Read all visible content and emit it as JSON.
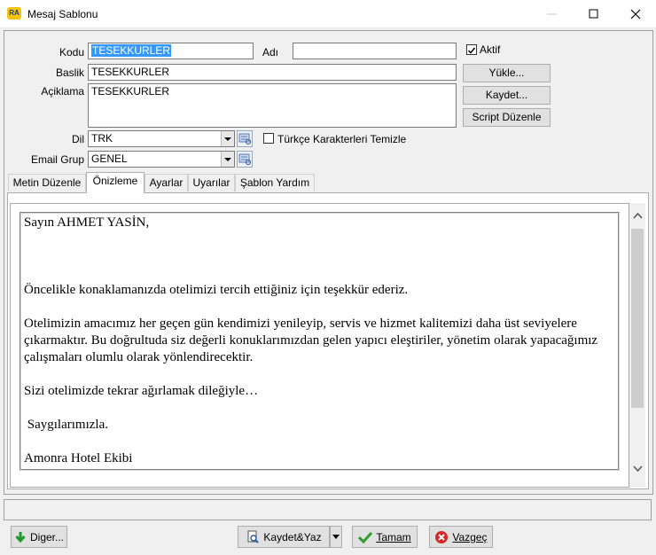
{
  "window": {
    "app_icon_text": "RA",
    "title": "Mesaj Sablonu"
  },
  "form": {
    "kodu_label": "Kodu",
    "kodu_value": "TESEKKURLER",
    "adi_label": "Adı",
    "adi_value": "",
    "aktif_label": "Aktif",
    "aktif_checked": true,
    "baslik_label": "Baslik",
    "baslik_value": "TESEKKURLER",
    "aciklama_label": "Açiklama",
    "aciklama_value": "TESEKKURLER",
    "dil_label": "Dil",
    "dil_value": "TRK",
    "turkce_label": "Türkçe Karakterleri Temizle",
    "turkce_checked": false,
    "email_grup_label": "Email Grup",
    "email_grup_value": "GENEL"
  },
  "side_buttons": {
    "yukle": "Yükle...",
    "kaydet": "Kaydet...",
    "script": "Script Düzenle"
  },
  "tabs": [
    {
      "label": "Metin Düzenle",
      "active": false
    },
    {
      "label": "Önizleme",
      "active": true
    },
    {
      "label": "Ayarlar",
      "active": false
    },
    {
      "label": "Uyarılar",
      "active": false
    },
    {
      "label": "Şablon Yardım",
      "active": false
    }
  ],
  "preview": {
    "lines": [
      "Sayın AHMET YASİN,",
      "",
      "",
      "",
      "Öncelikle konaklamanızda otelimizi tercih ettiğiniz için teşekkür ederiz.",
      "",
      "Otelimizin amacımız her geçen gün kendimizi yenileyip, servis ve hizmet kalitemizi daha üst seviyelere",
      "çıkarmaktır. Bu doğrultuda siz değerli konuklarımızdan gelen yapıcı eleştiriler, yönetim olarak yapacağımız",
      "çalışmaları olumlu olarak yönlendirecektir.",
      "",
      "Sizi otelimizde tekrar ağırlamak dileğiyle…",
      "",
      " Saygılarımızla.",
      "",
      "Amonra Hotel Ekibi"
    ]
  },
  "bottom_buttons": {
    "diger": "Diger...",
    "kaydet_yaz": "Kaydet&Yaz",
    "tamam": "Tamam",
    "vazgec": "Vazgeç"
  },
  "colors": {
    "selection": "#3399ff",
    "tamam_icon": "#2e9d2e",
    "vazgec_icon": "#d42828",
    "diger_icon": "#1c9b2b"
  }
}
